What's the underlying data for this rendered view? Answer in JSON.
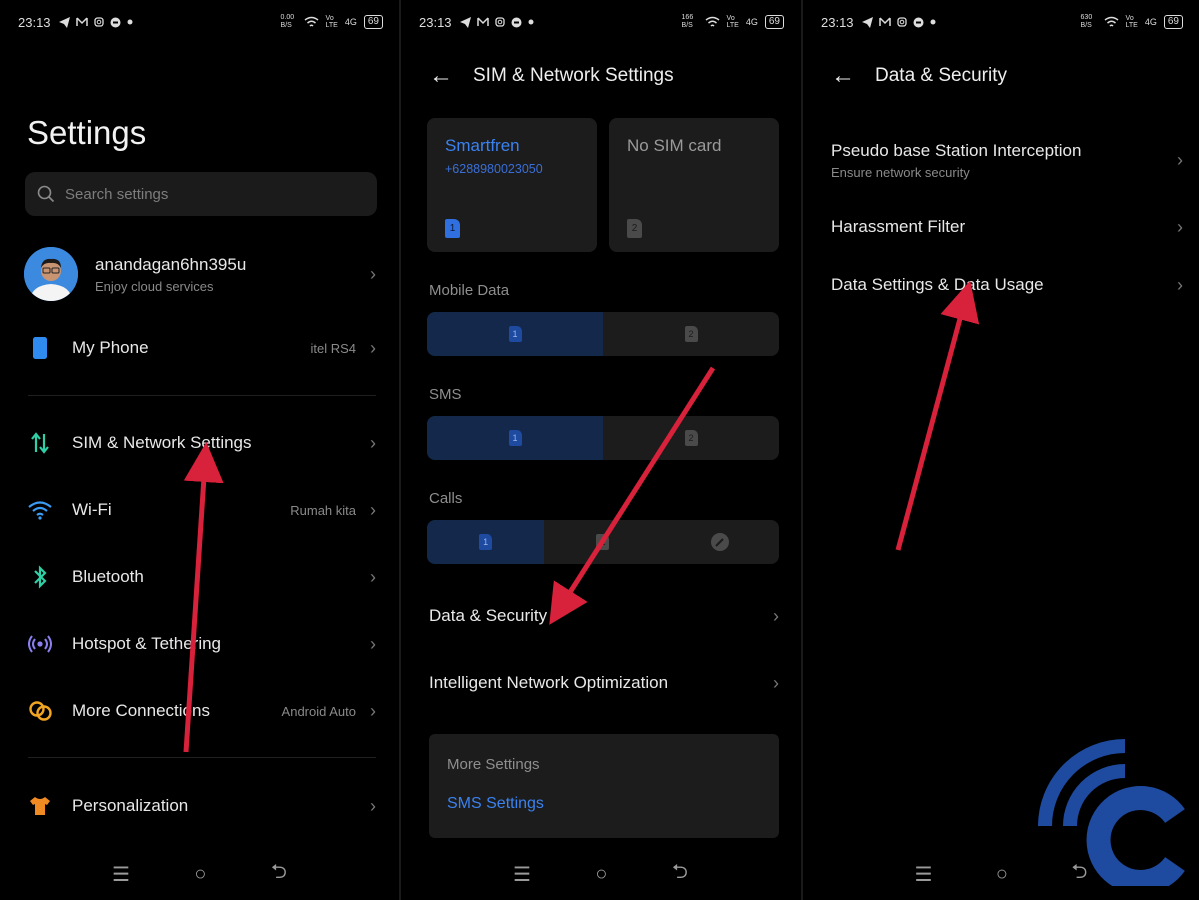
{
  "status": {
    "panel1": {
      "time": "23:13",
      "speed": "0.00 B/S",
      "battery": "69"
    },
    "panel2": {
      "time": "23:13",
      "speed": "166 B/S",
      "battery": "69"
    },
    "panel3": {
      "time": "23:13",
      "speed": "630 B/S",
      "battery": "69"
    },
    "network": "4G"
  },
  "panel1": {
    "title": "Settings",
    "search_placeholder": "Search settings",
    "account": {
      "name": "anandagan6hn395u",
      "subtitle": "Enjoy cloud services"
    },
    "items": [
      {
        "label": "My Phone",
        "value": "itel RS4"
      },
      {
        "label": "SIM & Network Settings",
        "value": ""
      },
      {
        "label": "Wi-Fi",
        "value": "Rumah kita"
      },
      {
        "label": "Bluetooth",
        "value": ""
      },
      {
        "label": "Hotspot & Tethering",
        "value": ""
      },
      {
        "label": "More Connections",
        "value": "Android Auto"
      },
      {
        "label": "Personalization",
        "value": ""
      }
    ]
  },
  "panel2": {
    "title": "SIM & Network Settings",
    "sim1": {
      "name": "Smartfren",
      "number": "+6288980023050",
      "slot": "1"
    },
    "sim2": {
      "name": "No SIM card",
      "slot": "2"
    },
    "mobile_data_label": "Mobile Data",
    "sms_label": "SMS",
    "calls_label": "Calls",
    "seg_slot1": "1",
    "seg_slot2": "2",
    "data_security": "Data & Security",
    "intelligent": "Intelligent Network Optimization",
    "more_title": "More Settings",
    "sms_settings": "SMS Settings"
  },
  "panel3": {
    "title": "Data & Security",
    "items": [
      {
        "label": "Pseudo base Station Interception",
        "sub": "Ensure network security"
      },
      {
        "label": "Harassment Filter",
        "sub": ""
      },
      {
        "label": "Data Settings & Data Usage",
        "sub": ""
      }
    ]
  },
  "navbar": {
    "menu": "☰",
    "home": "○",
    "back": "⮌"
  },
  "colors": {
    "accent_blue": "#3a82f0",
    "arrow_red": "#d8213a",
    "sim_blue": "#1e4aa0"
  }
}
